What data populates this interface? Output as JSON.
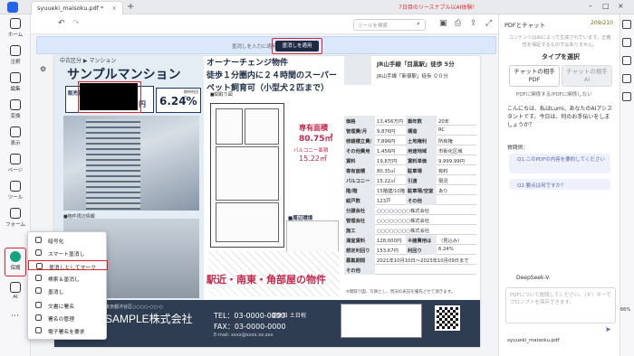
{
  "tab": {
    "title": "syuueki_maisoku.pdf *"
  },
  "promo": "7日目のリースナブル以AI体験！",
  "toolbar": {
    "search_placeholder": "ツールを検索"
  },
  "redact_bar": {
    "message": "墨消しを入力に適用します。",
    "apply_label": "墨消しを適用"
  },
  "sidebar": {
    "items": [
      {
        "label": "ホーム"
      },
      {
        "label": "注釈"
      },
      {
        "label": "編集"
      },
      {
        "label": "変換"
      },
      {
        "label": "表示"
      },
      {
        "label": "ページ"
      },
      {
        "label": "ツール"
      },
      {
        "label": "フォーム"
      },
      {
        "label": "保護"
      },
      {
        "label": "AI"
      }
    ]
  },
  "context_menu": {
    "items": [
      {
        "label": "暗号化"
      },
      {
        "label": "スマート墨消し"
      },
      {
        "label": "墨消しとしてマーク"
      },
      {
        "label": "検索＆墨消し"
      },
      {
        "label": "墨消し"
      },
      {
        "label": "文書に署名"
      },
      {
        "label": "署名の管理"
      },
      {
        "label": "電子署名を要求"
      }
    ]
  },
  "document": {
    "subtitle": "中古区分 ▶ マンション",
    "title": "サンプルマンション",
    "price_label": "販売価格",
    "price_suffix": "円",
    "yield_label": "期待利回り",
    "yield_value": "6.24%",
    "photo_caption_1": "■物件外観",
    "photo_caption_2": "■物件周辺情報",
    "catch": "オーナーチェンジ物件\n徒歩１分圏内に２４時間のスーパー\nペット飼育可（小型犬２匹まで）",
    "floor_caption": "■間取り図",
    "area_label": "専有面積",
    "area_value": "80.75㎡",
    "balcony_label": "バルコニー面積",
    "balcony_value": "15.22㎡",
    "env_head": "■周辺環境",
    "slogan": "駅近・南東・角部屋の物件",
    "station1": "JR山手線「目黒駅」徒歩 5分",
    "station2": "JR山手線「新宿駅」徒歩 ００分",
    "note": "※間取り図、写真とし、現況の表記を優先させて頂きます。",
    "spec": [
      [
        "価格",
        "13,456万円",
        "築年数",
        "20年"
      ],
      [
        "管理費/月",
        "9,876円",
        "構造",
        "RC"
      ],
      [
        "修繕積立費/月",
        "7,896円",
        "土地権利",
        "所有権"
      ],
      [
        "その他費用",
        "1,456円",
        "用途地域",
        "市街化区域"
      ],
      [
        "賃料",
        "19,8万円",
        "賃料単価",
        "9,999.99円"
      ],
      [
        "専有面積",
        "80.35㎡",
        "駐車場",
        "有料"
      ],
      [
        "バルコニー",
        "15.22㎡",
        "引渡",
        "現況"
      ],
      [
        "階/階",
        "15階建/10階",
        "駐車場/空室",
        "あり"
      ],
      [
        "総戸数",
        "123戸",
        "その他",
        ""
      ],
      [
        "分譲会社",
        "○○○○○○○○株式会社",
        "",
        " "
      ],
      [
        "管理会社",
        "○○○○○○○○株式会社",
        "",
        " "
      ],
      [
        "施工",
        "○○○○○○○○株式会社",
        "",
        " "
      ],
      [
        "満室賃料",
        "128,000円",
        "※諸費用は別途",
        "（見込み）"
      ],
      [
        "想定利回り",
        "153.67円",
        "利回り",
        "6.24%"
      ],
      [
        "募集期間",
        "2021年10月10日〜2023年10月09日まで",
        "",
        " "
      ],
      [
        "その他",
        "",
        "",
        " "
      ]
    ],
    "footer": {
      "addr": "東京都渋谷区○○○○-○○-○",
      "company": "SAMPLE株式会社",
      "tel": "TEL：03-0000-0000",
      "fax": "FAX：03-0000-0000",
      "hours": "定休日 土日祝",
      "email": "E-mail: xxxx@xxxx.xx.xxx"
    }
  },
  "right_panel": {
    "title": "PDFとチャット",
    "credits": "209/210",
    "info": "コンテンツはAIによって生成されています。正確性を保証するものではありません。",
    "type_heading": "タイプを選択",
    "chat_btn1": "チャットの相手\nPDF",
    "chat_btn2": "チャットの相手\nAI",
    "type_sub": "PDFに関係する/PDFに関係しない",
    "greeting": "こんにちは、私はLumi。あなたのAIアシスタントです。今日は、何のお手伝いをしましょうか？",
    "questions_head": "質問例：",
    "q1": "Q1.このPDFの内容を要約してください",
    "q2": "Q2.要点は何ですか？",
    "model": "DeepSeek-V.",
    "input_placeholder": "PDFについて質問してください。（＃）キーでプロンプトを保存できます。",
    "file_chip": "syuueki_maisoku.pdf"
  },
  "zoom": "66%"
}
